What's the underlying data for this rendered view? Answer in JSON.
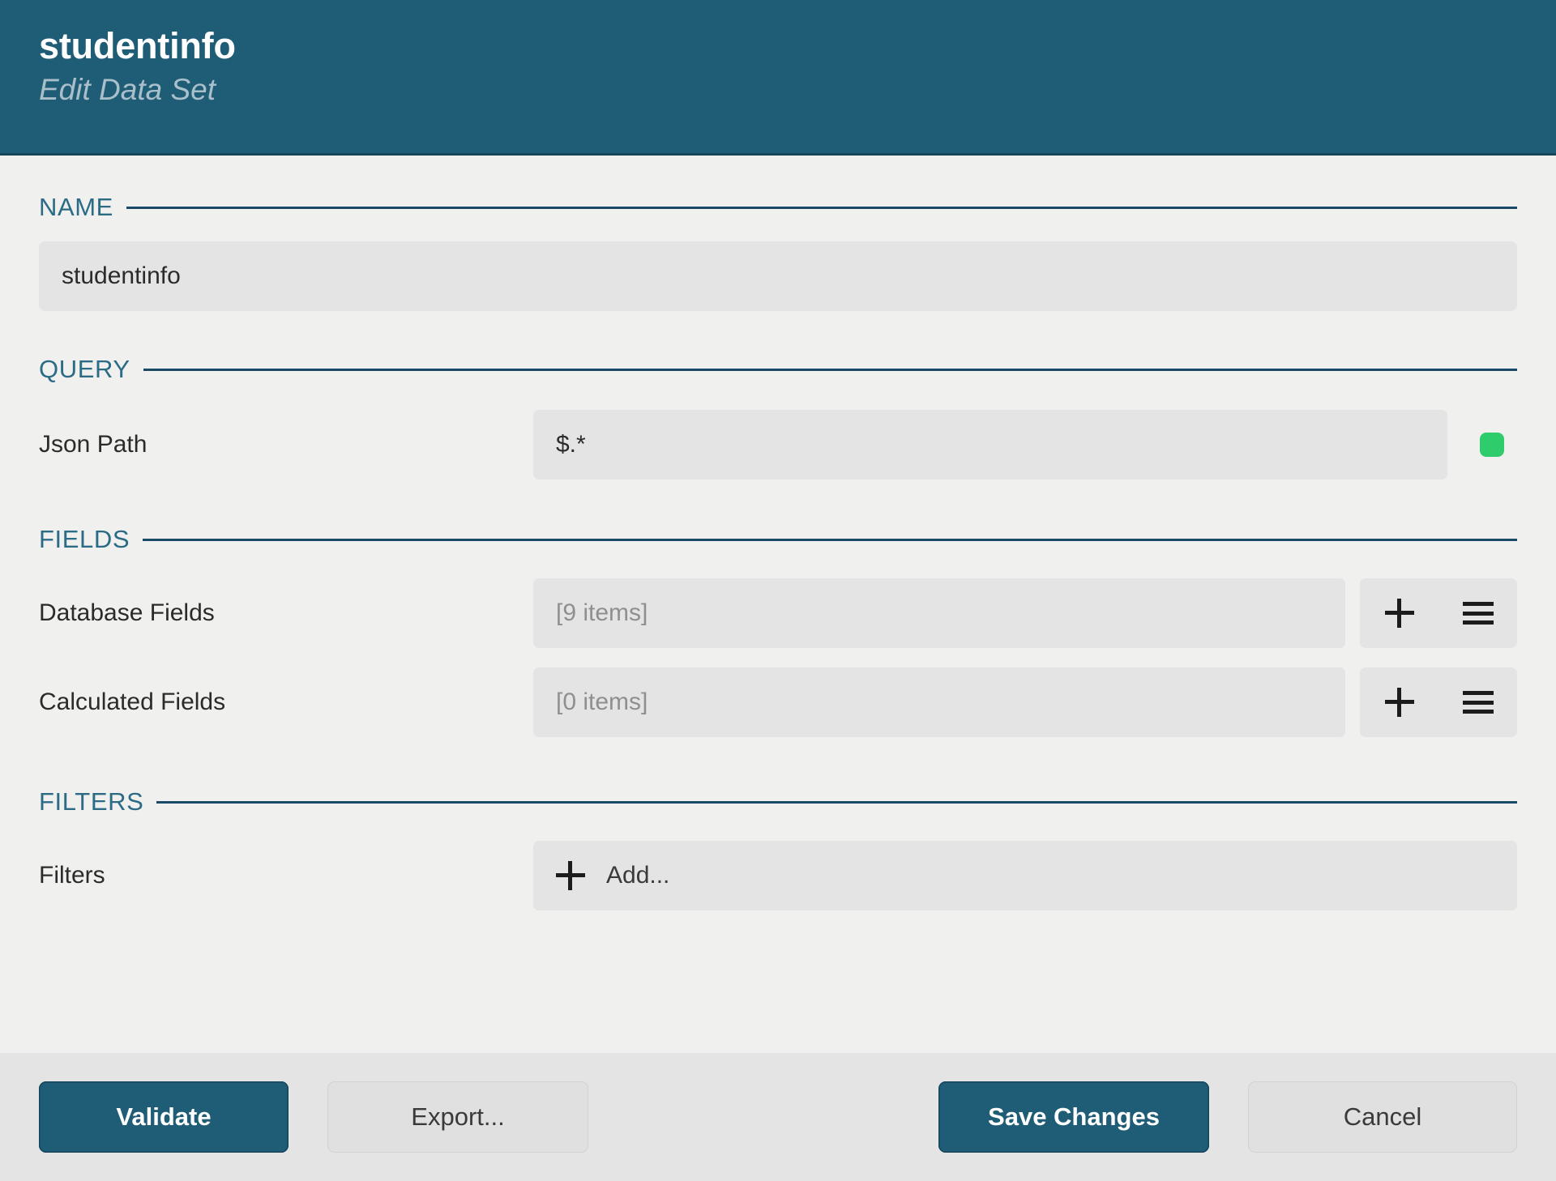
{
  "header": {
    "title": "studentinfo",
    "subtitle": "Edit Data Set",
    "background_color": "#1f5d76",
    "title_color": "#ffffff",
    "subtitle_color": "#a9bfc9"
  },
  "sections": {
    "name": {
      "label": "NAME",
      "input_value": "studentinfo"
    },
    "query": {
      "label": "QUERY",
      "json_path_label": "Json Path",
      "json_path_value": "$.*",
      "status_color": "#2ecc6b",
      "status_name": "valid"
    },
    "fields": {
      "label": "FIELDS",
      "rows": [
        {
          "label": "Database Fields",
          "value": "[9 items]",
          "add_icon": "plus-icon",
          "menu_icon": "hamburger-icon"
        },
        {
          "label": "Calculated Fields",
          "value": "[0 items]",
          "add_icon": "plus-icon",
          "menu_icon": "hamburger-icon"
        }
      ]
    },
    "filters": {
      "label": "FILTERS",
      "row_label": "Filters",
      "add_label": "Add...",
      "add_icon": "plus-icon"
    }
  },
  "footer": {
    "validate_label": "Validate",
    "export_label": "Export...",
    "save_label": "Save Changes",
    "cancel_label": "Cancel",
    "primary_color": "#1f5d76",
    "secondary_color": "#e0e0e0"
  }
}
